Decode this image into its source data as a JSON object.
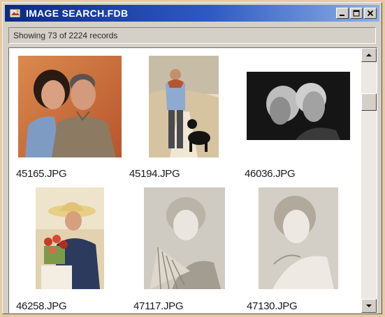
{
  "window": {
    "title": "IMAGE SEARCH.FDB",
    "status": "Showing 73 of 2224 records"
  },
  "icons": {
    "app": "app-icon",
    "minimize": "minimize-icon",
    "maximize": "maximize-icon",
    "close": "close-icon",
    "scroll_up": "arrow-up-icon",
    "scroll_down": "arrow-down-icon"
  },
  "colors": {
    "titlebar_start": "#0a2a86",
    "titlebar_end": "#8fb0e4",
    "window_face": "#d4d0c8",
    "content_bg": "#ffffff"
  },
  "images": [
    {
      "filename": "45165.JPG"
    },
    {
      "filename": "45194.JPG"
    },
    {
      "filename": "46036.JPG"
    },
    {
      "filename": "46258.JPG"
    },
    {
      "filename": "47117.JPG"
    },
    {
      "filename": "47130.JPG"
    }
  ]
}
